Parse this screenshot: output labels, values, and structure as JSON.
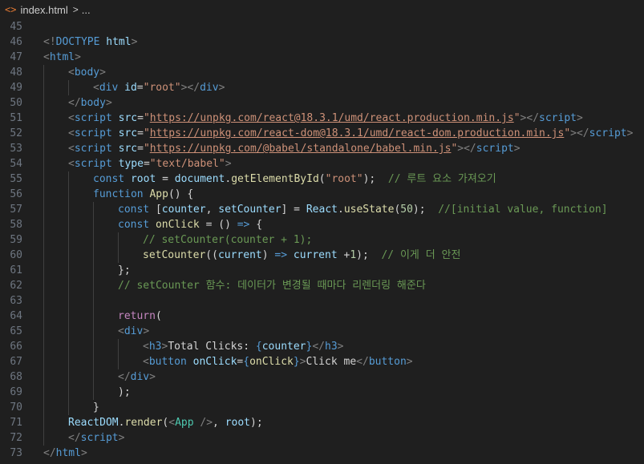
{
  "breadcrumb": {
    "file_icon": "<>",
    "file_name": "index.html",
    "separator": ">",
    "ellipsis": "..."
  },
  "lines": [
    {
      "n": "45",
      "indent": 0,
      "tokens": []
    },
    {
      "n": "46",
      "indent": 0,
      "tokens": [
        [
          "tk-punct",
          "<!"
        ],
        [
          "tk-tag",
          "DOCTYPE"
        ],
        [
          "tk-plain",
          " "
        ],
        [
          "tk-attr",
          "html"
        ],
        [
          "tk-punct",
          ">"
        ]
      ]
    },
    {
      "n": "47",
      "indent": 0,
      "tokens": [
        [
          "tk-punct",
          "<"
        ],
        [
          "tk-tag",
          "html"
        ],
        [
          "tk-punct",
          ">"
        ]
      ]
    },
    {
      "n": "48",
      "indent": 1,
      "tokens": [
        [
          "tk-punct",
          "<"
        ],
        [
          "tk-tag",
          "body"
        ],
        [
          "tk-punct",
          ">"
        ]
      ]
    },
    {
      "n": "49",
      "indent": 2,
      "tokens": [
        [
          "tk-punct",
          "<"
        ],
        [
          "tk-tag",
          "div"
        ],
        [
          "tk-plain",
          " "
        ],
        [
          "tk-attr",
          "id"
        ],
        [
          "tk-plain",
          "="
        ],
        [
          "tk-str",
          "\"root\""
        ],
        [
          "tk-punct",
          "></"
        ],
        [
          "tk-tag",
          "div"
        ],
        [
          "tk-punct",
          ">"
        ]
      ]
    },
    {
      "n": "50",
      "indent": 1,
      "tokens": [
        [
          "tk-punct",
          "</"
        ],
        [
          "tk-tag",
          "body"
        ],
        [
          "tk-punct",
          ">"
        ]
      ]
    },
    {
      "n": "51",
      "indent": 1,
      "tokens": [
        [
          "tk-punct",
          "<"
        ],
        [
          "tk-tag",
          "script"
        ],
        [
          "tk-plain",
          " "
        ],
        [
          "tk-attr",
          "src"
        ],
        [
          "tk-plain",
          "="
        ],
        [
          "tk-str",
          "\""
        ],
        [
          "tk-link",
          "https://unpkg.com/react@18.3.1/umd/react.production.min.js"
        ],
        [
          "tk-str",
          "\""
        ],
        [
          "tk-punct",
          "></"
        ],
        [
          "tk-tag",
          "script"
        ],
        [
          "tk-punct",
          ">"
        ]
      ]
    },
    {
      "n": "52",
      "indent": 1,
      "tokens": [
        [
          "tk-punct",
          "<"
        ],
        [
          "tk-tag",
          "script"
        ],
        [
          "tk-plain",
          " "
        ],
        [
          "tk-attr",
          "src"
        ],
        [
          "tk-plain",
          "="
        ],
        [
          "tk-str",
          "\""
        ],
        [
          "tk-link",
          "https://unpkg.com/react-dom@18.3.1/umd/react-dom.production.min.js"
        ],
        [
          "tk-str",
          "\""
        ],
        [
          "tk-punct",
          "></"
        ],
        [
          "tk-tag",
          "script"
        ],
        [
          "tk-punct",
          ">"
        ]
      ]
    },
    {
      "n": "53",
      "indent": 1,
      "tokens": [
        [
          "tk-punct",
          "<"
        ],
        [
          "tk-tag",
          "script"
        ],
        [
          "tk-plain",
          " "
        ],
        [
          "tk-attr",
          "src"
        ],
        [
          "tk-plain",
          "="
        ],
        [
          "tk-str",
          "\""
        ],
        [
          "tk-link",
          "https://unpkg.com/@babel/standalone/babel.min.js"
        ],
        [
          "tk-str",
          "\""
        ],
        [
          "tk-punct",
          "></"
        ],
        [
          "tk-tag",
          "script"
        ],
        [
          "tk-punct",
          ">"
        ]
      ]
    },
    {
      "n": "54",
      "indent": 1,
      "tokens": [
        [
          "tk-punct",
          "<"
        ],
        [
          "tk-tag",
          "script"
        ],
        [
          "tk-plain",
          " "
        ],
        [
          "tk-attr",
          "type"
        ],
        [
          "tk-plain",
          "="
        ],
        [
          "tk-str",
          "\"text/babel\""
        ],
        [
          "tk-punct",
          ">"
        ]
      ]
    },
    {
      "n": "55",
      "indent": 2,
      "tokens": [
        [
          "tk-kw",
          "const"
        ],
        [
          "tk-plain",
          " "
        ],
        [
          "tk-var",
          "root"
        ],
        [
          "tk-plain",
          " = "
        ],
        [
          "tk-var",
          "document"
        ],
        [
          "tk-plain",
          "."
        ],
        [
          "tk-fn",
          "getElementById"
        ],
        [
          "tk-plain",
          "("
        ],
        [
          "tk-str",
          "\"root\""
        ],
        [
          "tk-plain",
          ");  "
        ],
        [
          "tk-comment",
          "// 루트 요소 가져오기"
        ]
      ]
    },
    {
      "n": "56",
      "indent": 2,
      "tokens": [
        [
          "tk-kw",
          "function"
        ],
        [
          "tk-plain",
          " "
        ],
        [
          "tk-fn",
          "App"
        ],
        [
          "tk-plain",
          "() {"
        ]
      ]
    },
    {
      "n": "57",
      "indent": 3,
      "tokens": [
        [
          "tk-kw",
          "const"
        ],
        [
          "tk-plain",
          " ["
        ],
        [
          "tk-var",
          "counter"
        ],
        [
          "tk-plain",
          ", "
        ],
        [
          "tk-var",
          "setCounter"
        ],
        [
          "tk-plain",
          "] = "
        ],
        [
          "tk-var",
          "React"
        ],
        [
          "tk-plain",
          "."
        ],
        [
          "tk-fn",
          "useState"
        ],
        [
          "tk-plain",
          "("
        ],
        [
          "tk-num",
          "50"
        ],
        [
          "tk-plain",
          ");  "
        ],
        [
          "tk-comment",
          "//[initial value, function]"
        ]
      ]
    },
    {
      "n": "58",
      "indent": 3,
      "tokens": [
        [
          "tk-kw",
          "const"
        ],
        [
          "tk-plain",
          " "
        ],
        [
          "tk-fn",
          "onClick"
        ],
        [
          "tk-plain",
          " = () "
        ],
        [
          "tk-kw",
          "=>"
        ],
        [
          "tk-plain",
          " {"
        ]
      ]
    },
    {
      "n": "59",
      "indent": 4,
      "tokens": [
        [
          "tk-comment",
          "// setCounter(counter + 1);"
        ]
      ]
    },
    {
      "n": "60",
      "indent": 4,
      "tokens": [
        [
          "tk-fn",
          "setCounter"
        ],
        [
          "tk-plain",
          "(("
        ],
        [
          "tk-var",
          "current"
        ],
        [
          "tk-plain",
          ") "
        ],
        [
          "tk-kw",
          "=>"
        ],
        [
          "tk-plain",
          " "
        ],
        [
          "tk-var",
          "current"
        ],
        [
          "tk-plain",
          " +"
        ],
        [
          "tk-num",
          "1"
        ],
        [
          "tk-plain",
          ");  "
        ],
        [
          "tk-comment",
          "// 이게 더 안전"
        ]
      ]
    },
    {
      "n": "61",
      "indent": 3,
      "tokens": [
        [
          "tk-plain",
          "};"
        ]
      ]
    },
    {
      "n": "62",
      "indent": 3,
      "tokens": [
        [
          "tk-comment",
          "// setCounter 함수: 데이터가 변경될 때마다 리렌더링 해준다"
        ]
      ]
    },
    {
      "n": "63",
      "indent": 3,
      "tokens": []
    },
    {
      "n": "64",
      "indent": 3,
      "tokens": [
        [
          "tk-ctrl",
          "return"
        ],
        [
          "tk-plain",
          "("
        ]
      ]
    },
    {
      "n": "65",
      "indent": 3,
      "tokens": [
        [
          "tk-punct",
          "<"
        ],
        [
          "tk-tag",
          "div"
        ],
        [
          "tk-punct",
          ">"
        ]
      ]
    },
    {
      "n": "66",
      "indent": 4,
      "tokens": [
        [
          "tk-punct",
          "<"
        ],
        [
          "tk-tag",
          "h3"
        ],
        [
          "tk-punct",
          ">"
        ],
        [
          "tk-text",
          "Total Clicks: "
        ],
        [
          "tk-kw",
          "{"
        ],
        [
          "tk-var",
          "counter"
        ],
        [
          "tk-kw",
          "}"
        ],
        [
          "tk-punct",
          "</"
        ],
        [
          "tk-tag",
          "h3"
        ],
        [
          "tk-punct",
          ">"
        ]
      ]
    },
    {
      "n": "67",
      "indent": 4,
      "tokens": [
        [
          "tk-punct",
          "<"
        ],
        [
          "tk-tag",
          "button"
        ],
        [
          "tk-plain",
          " "
        ],
        [
          "tk-attr",
          "onClick"
        ],
        [
          "tk-plain",
          "="
        ],
        [
          "tk-kw",
          "{"
        ],
        [
          "tk-fn",
          "onClick"
        ],
        [
          "tk-kw",
          "}"
        ],
        [
          "tk-punct",
          ">"
        ],
        [
          "tk-text",
          "Click me"
        ],
        [
          "tk-punct",
          "</"
        ],
        [
          "tk-tag",
          "button"
        ],
        [
          "tk-punct",
          ">"
        ]
      ]
    },
    {
      "n": "68",
      "indent": 3,
      "tokens": [
        [
          "tk-punct",
          "</"
        ],
        [
          "tk-tag",
          "div"
        ],
        [
          "tk-punct",
          ">"
        ]
      ]
    },
    {
      "n": "69",
      "indent": 3,
      "tokens": [
        [
          "tk-plain",
          ");"
        ]
      ]
    },
    {
      "n": "70",
      "indent": 2,
      "tokens": [
        [
          "tk-plain",
          "}"
        ]
      ]
    },
    {
      "n": "71",
      "indent": 1,
      "tokens": [
        [
          "tk-var",
          "ReactDOM"
        ],
        [
          "tk-plain",
          "."
        ],
        [
          "tk-fn",
          "render"
        ],
        [
          "tk-plain",
          "("
        ],
        [
          "tk-punct",
          "<"
        ],
        [
          "tk-comp",
          "App"
        ],
        [
          "tk-plain",
          " "
        ],
        [
          "tk-punct",
          "/>"
        ],
        [
          "tk-plain",
          ", "
        ],
        [
          "tk-var",
          "root"
        ],
        [
          "tk-plain",
          ");"
        ]
      ]
    },
    {
      "n": "72",
      "indent": 1,
      "tokens": [
        [
          "tk-punct",
          "</"
        ],
        [
          "tk-tag",
          "script"
        ],
        [
          "tk-punct",
          ">"
        ]
      ]
    },
    {
      "n": "73",
      "indent": 0,
      "tokens": [
        [
          "tk-punct",
          "</"
        ],
        [
          "tk-tag",
          "html"
        ],
        [
          "tk-punct",
          ">"
        ]
      ]
    }
  ]
}
